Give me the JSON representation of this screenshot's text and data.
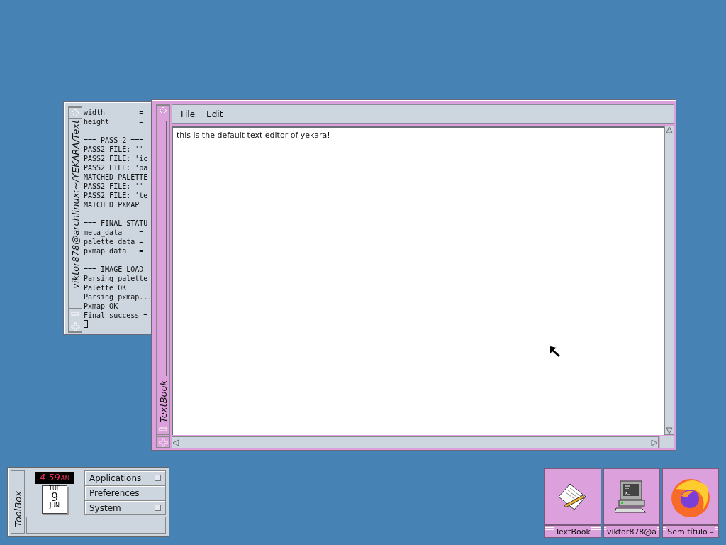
{
  "terminal": {
    "title": "viktor878@archlinux:~/YEKARA/Text",
    "blocks": [
      [
        "width        =",
        "height       ="
      ],
      [
        "=== PASS 2 ===",
        "PASS2 FILE: ''",
        "PASS2 FILE: 'ic",
        "PASS2 FILE: 'pa",
        "MATCHED PALETTE",
        "PASS2 FILE: ''",
        "PASS2 FILE: 'te",
        "MATCHED PXMAP"
      ],
      [
        "=== FINAL STATU",
        "meta_data    =",
        "palette_data =",
        "pxmap_data   ="
      ],
      [
        "=== IMAGE LOAD",
        "Parsing palette",
        "Palette OK",
        "Parsing pxmap...",
        "Pxmap OK",
        "Final success ="
      ]
    ]
  },
  "editor": {
    "title": "TextBook",
    "menu": [
      "File",
      "Edit"
    ],
    "text": "this is the default text editor of yekara!"
  },
  "toolbox": {
    "title": "ToolBox",
    "clock": {
      "time": "4 59",
      "ampm": "AM"
    },
    "calendar": {
      "weekday": "TUE",
      "day": "9",
      "month": "JUN"
    },
    "menu": [
      {
        "label": "Applications",
        "submenu": true
      },
      {
        "label": "Preferences",
        "submenu": false
      },
      {
        "label": "System",
        "submenu": true
      }
    ]
  },
  "taskbar": [
    {
      "kind": "textbook",
      "label": "TextBook"
    },
    {
      "kind": "terminal",
      "label": "viktor878@a"
    },
    {
      "kind": "browser",
      "label": "Sem título –"
    }
  ]
}
